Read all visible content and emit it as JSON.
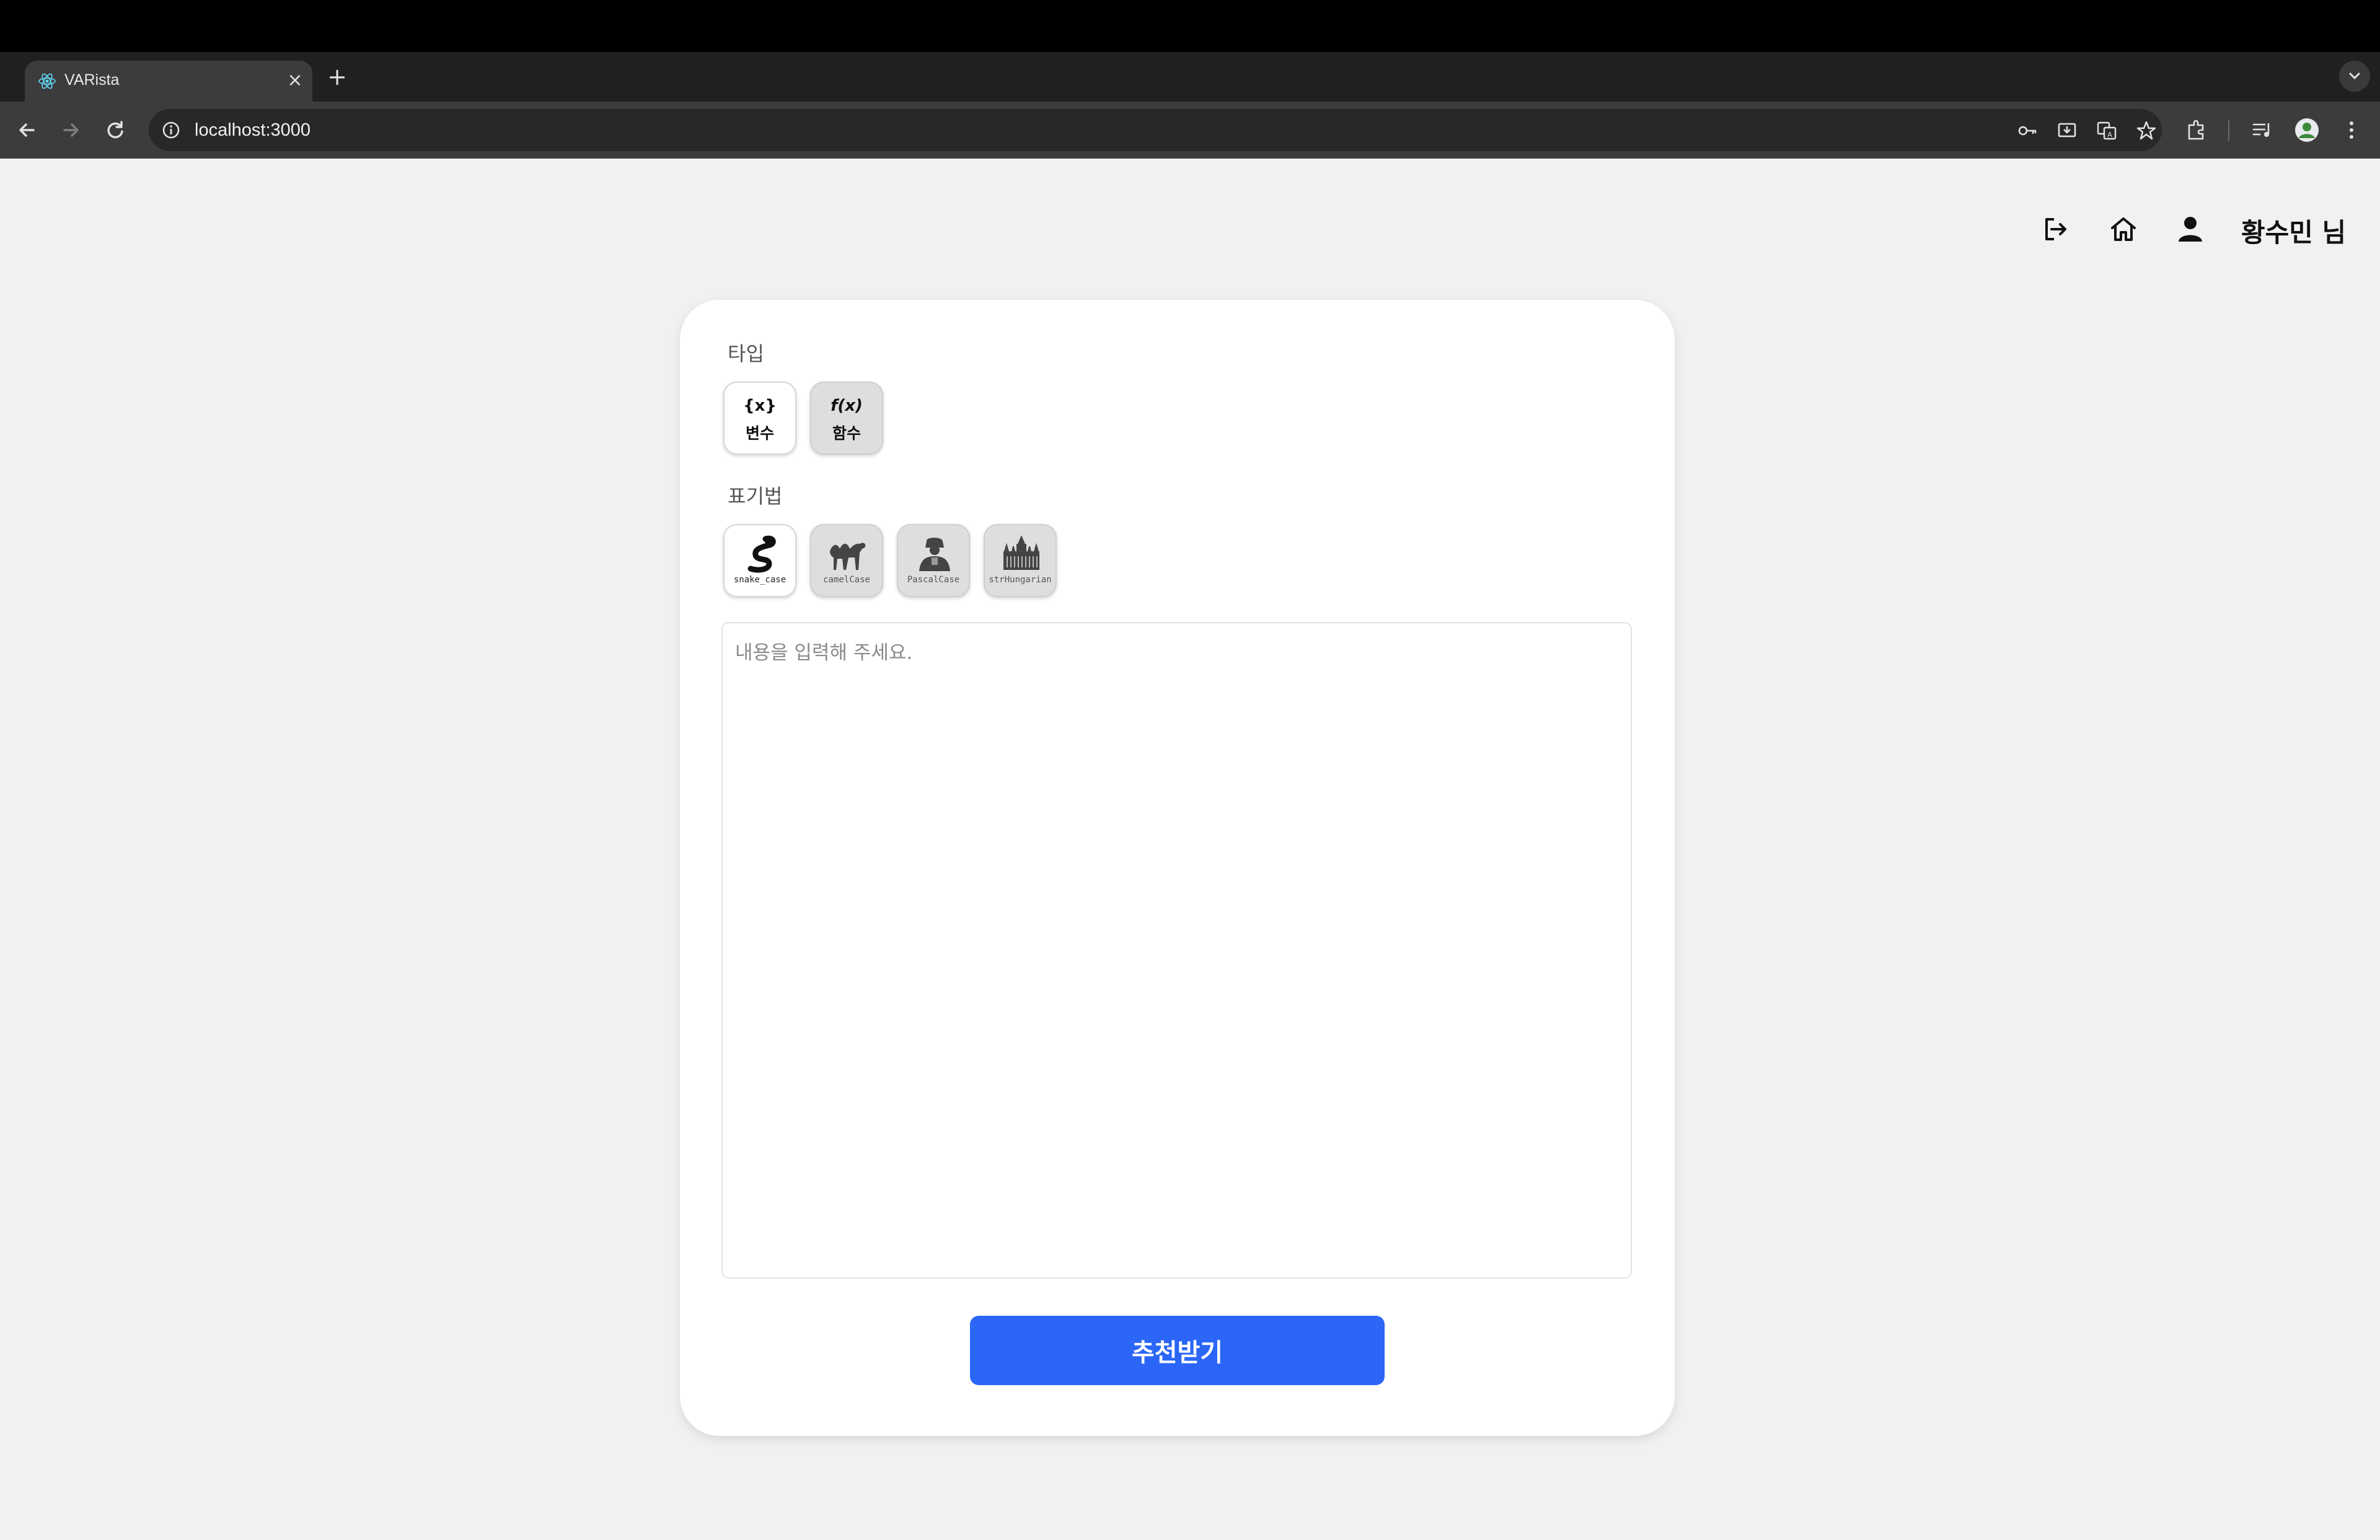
{
  "browser": {
    "tab_title": "VARista",
    "url": "localhost:3000"
  },
  "header": {
    "user_name": "황수민 님",
    "icons": [
      "logout-icon",
      "home-icon",
      "user-icon"
    ]
  },
  "form": {
    "type_label": "타입",
    "type_options": [
      {
        "symbol": "{x}",
        "label": "변수",
        "selected": true
      },
      {
        "symbol": "f(x)",
        "label": "함수",
        "selected": false
      }
    ],
    "notation_label": "표기법",
    "notation_options": [
      {
        "label": "snake_case",
        "icon": "snake-icon",
        "selected": true
      },
      {
        "label": "camelCase",
        "icon": "camel-icon",
        "selected": false
      },
      {
        "label": "PascalCase",
        "icon": "pascal-icon",
        "selected": false
      },
      {
        "label": "strHungarian",
        "icon": "parliament-icon",
        "selected": false
      }
    ],
    "input_placeholder": "내용을 입력해 주세요.",
    "submit_label": "추천받기"
  },
  "colors": {
    "accent": "#2b66f6",
    "background": "#f1f1f1"
  }
}
